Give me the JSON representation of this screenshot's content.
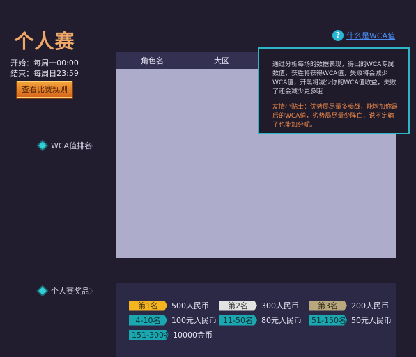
{
  "sidebar": {
    "title": "个人赛",
    "start_time": "开始：每周一00:00",
    "end_time": "结束：每周日23:59",
    "rules_button": "查看比赛规则",
    "nav_items": [
      "WCA值排名",
      "个人赛奖品"
    ]
  },
  "ranking": {
    "columns": [
      "角色名",
      "大区"
    ],
    "wca_link": "什么是WCA值",
    "help_icon": "?"
  },
  "tooltip": {
    "main": "通过分析每场的数据表现，得出的WCA专属数值，获胜将获得WCA值，失败将会减少WCA值，开黑将减少你的WCA值收益，失败了还会减少更多哦",
    "tip": "友情小贴士：优势局尽量多参战，能增加你最后的WCA值，劣势局尽量少阵亡，说不定输了也能加分呢。"
  },
  "prizes": [
    {
      "rank": "第1名",
      "reward": "500人民币"
    },
    {
      "rank": "第2名",
      "reward": "300人民币"
    },
    {
      "rank": "第3名",
      "reward": "200人民币"
    },
    {
      "rank": "4-10名",
      "reward": "100元人民币"
    },
    {
      "rank": "11-50名",
      "reward": "80元人民币"
    },
    {
      "rank": "51-150名",
      "reward": "50元人民币"
    },
    {
      "rank": "151-300名",
      "reward": "10000金币"
    }
  ],
  "colors": {
    "accent_cyan": "#2bb7c8",
    "gold": "#f5b521",
    "silver": "#e2e2e2",
    "bronze": "#b9a77d",
    "teal": "#1aa7b0"
  }
}
